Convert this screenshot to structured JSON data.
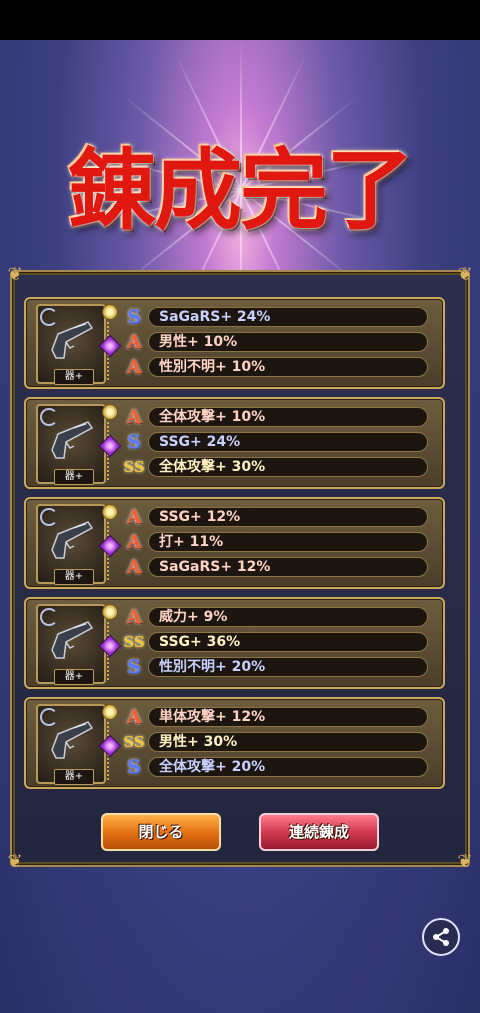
{
  "title": "錬成完了",
  "weapon_tag": "器+",
  "rows": [
    {
      "stats": [
        {
          "rank": "S",
          "text": "SaGaRS+ 24%"
        },
        {
          "rank": "A",
          "text": "男性+ 10%"
        },
        {
          "rank": "A",
          "text": "性別不明+ 10%"
        }
      ]
    },
    {
      "stats": [
        {
          "rank": "A",
          "text": "全体攻撃+ 10%"
        },
        {
          "rank": "S",
          "text": "SSG+ 24%"
        },
        {
          "rank": "SS",
          "text": "全体攻撃+ 30%"
        }
      ]
    },
    {
      "stats": [
        {
          "rank": "A",
          "text": "SSG+ 12%"
        },
        {
          "rank": "A",
          "text": "打+ 11%"
        },
        {
          "rank": "A",
          "text": "SaGaRS+ 12%"
        }
      ]
    },
    {
      "stats": [
        {
          "rank": "A",
          "text": "威力+ 9%"
        },
        {
          "rank": "SS",
          "text": "SSG+ 36%"
        },
        {
          "rank": "S",
          "text": "性別不明+ 20%"
        }
      ]
    },
    {
      "stats": [
        {
          "rank": "A",
          "text": "単体攻撃+ 12%"
        },
        {
          "rank": "SS",
          "text": "男性+ 30%"
        },
        {
          "rank": "S",
          "text": "全体攻撃+ 20%"
        }
      ]
    }
  ],
  "buttons": {
    "close": "閉じる",
    "continue": "連続錬成"
  },
  "icons": {
    "rank_glyphs": {
      "A": "A",
      "S": "S",
      "SS": "SS"
    },
    "share": "share-icon",
    "weapon": "handgun-icon"
  }
}
